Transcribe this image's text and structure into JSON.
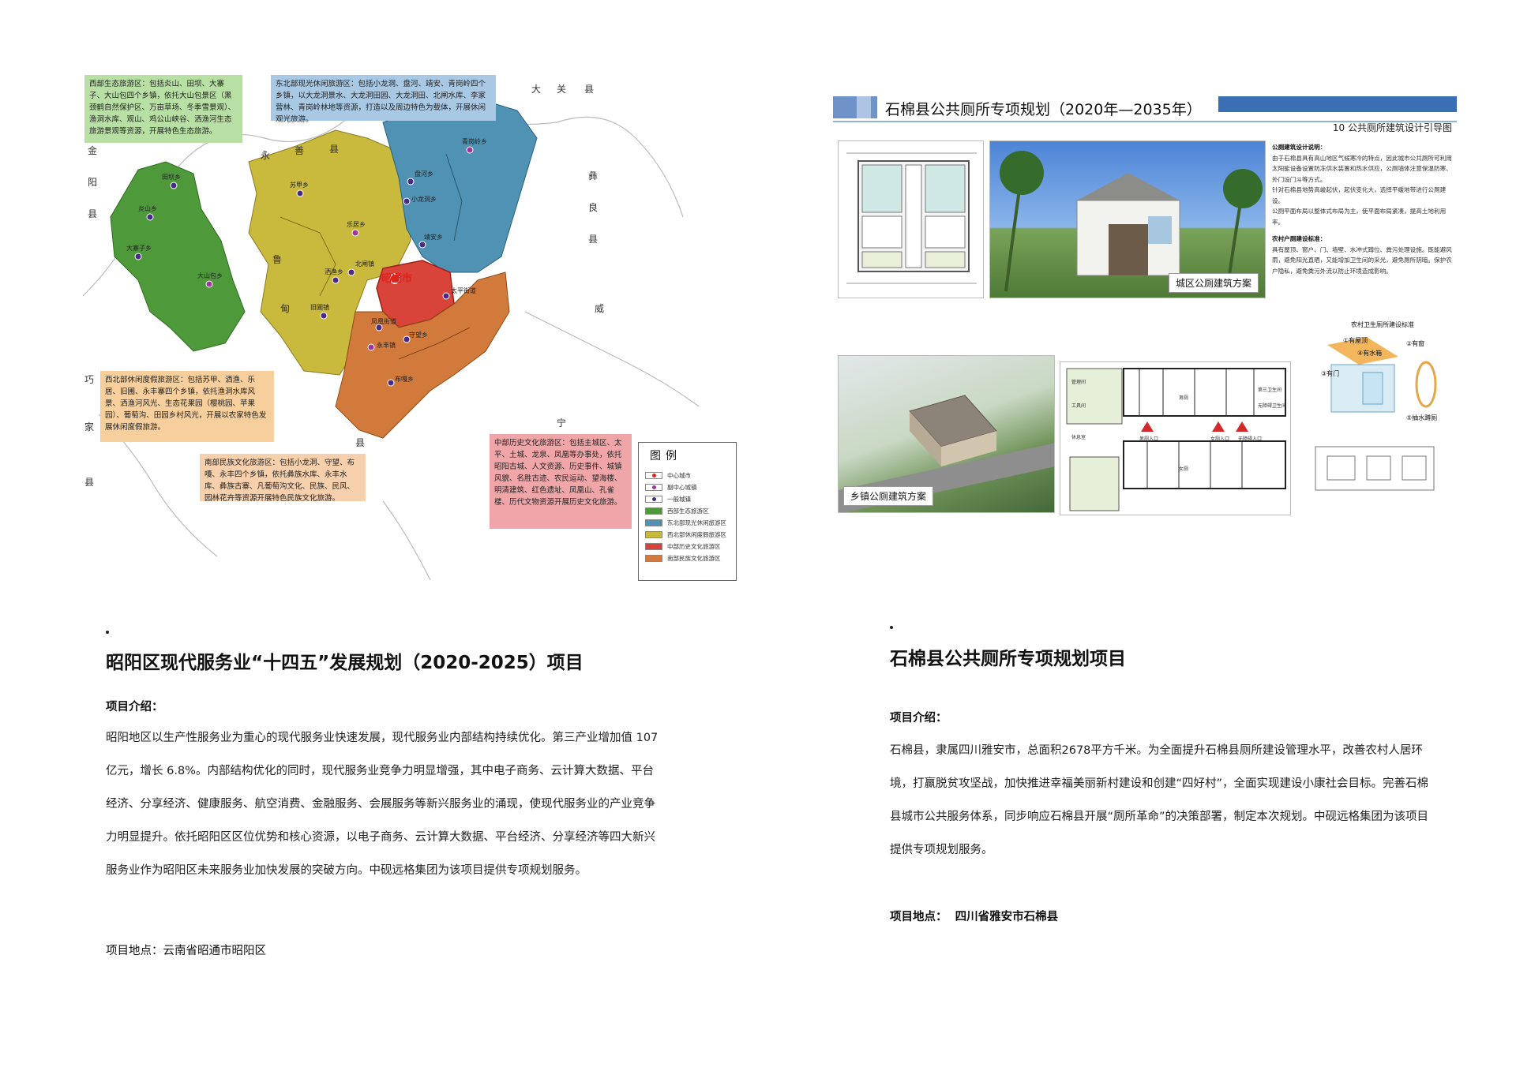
{
  "map": {
    "zone_notes": {
      "west": "西部生态旅游区：包括炎山、田坝、大寨子、大山包四个乡镇，依托大山包景区（黑颈鹤自然保护区、万亩草场、冬季雪景观）、渔洞水库、观山、鸡公山峡谷、洒渔河生态旅游景观等资源，开展特色生态旅游。",
      "northeast": "东北部现光休闲旅游区：包括小龙洞、盘河、靖安、青岗岭四个乡镇，以大龙洞景水、大龙洞田园、大龙洞田、北闸水库、李家营林、青岗岭林地等资源，打造以及周边特色为载体，开展休闲观光旅游。",
      "northwest": "西北部休闲度假旅游区：包括苏甲、洒渔、乐居、旧圃、永丰寨四个乡镇，依托渔洞水库风景、洒渔河风光、生态花果园（樱桃园、苹果园）、葡萄沟、田园乡村风光，开展以农家特色发展休闲度假旅游。",
      "south": "南部民族文化旅游区：包括小龙洞、守望、布嘎、永丰四个乡镇，依托彝族水库、永丰水库、彝族古寨、凡葡萄沟文化、民族、民风、园林花卉等资源开展特色民族文化旅游。",
      "central": "中部历史文化旅游区：包括主城区、太平、土城、龙泉、凤凰等办事处，依托昭阳古城、人文资源、历史事件、城镇风貌、名胜古迹、农民运动、望海楼、明清建筑、红色遗址、凤凰山、孔雀楼、历代文物资源开展历史文化旅游。"
    },
    "county_chars": {
      "jin_yang": [
        "金",
        "阳",
        "县"
      ],
      "yong_shan": [
        "永",
        "善",
        "县"
      ],
      "da_guan": [
        "大",
        "关",
        "县"
      ],
      "yi_liang": [
        "彝",
        "良",
        "县"
      ],
      "lu_dian": [
        "鲁",
        "甸",
        "县"
      ],
      "wei_ning": [
        "威",
        "宁"
      ],
      "qiao_jia": [
        "巧",
        "家",
        "县"
      ]
    },
    "places": {
      "zhaotong": "昭通市",
      "tianba": "田坝乡",
      "dashanbao": "大山包乡",
      "yanshan": "炎山乡",
      "dazhaizi": "大寨子乡",
      "sujia": "苏甲乡",
      "leju": "乐居乡",
      "sayu": "洒渔乡",
      "jingan": "靖安乡",
      "xiaolongdong": "小龙洞乡",
      "panhe": "盘河乡",
      "qinggangling": "青岗岭乡",
      "jiuyan": "旧圃镇",
      "yongfeng": "永丰镇",
      "taiping": "太平街道",
      "bujia": "布嘎乡",
      "shouwang": "守望乡",
      "beizha": "北闸镇",
      "fenghuang": "凤凰街道"
    },
    "legend": {
      "title": "图例",
      "items": [
        {
          "label": "中心城市",
          "swatch": "#ffffff",
          "marker": "center"
        },
        {
          "label": "副中心城镇",
          "swatch": "#ffffff",
          "marker": "sub"
        },
        {
          "label": "一般城镇",
          "swatch": "#ffffff",
          "marker": "town"
        },
        {
          "label": "西部生态旅游区",
          "swatch": "#4e9a3a"
        },
        {
          "label": "东北部现光休闲旅游区",
          "swatch": "#4f92b3"
        },
        {
          "label": "西北部休闲度假旅游区",
          "swatch": "#c9b93c"
        },
        {
          "label": "中部历史文化旅游区",
          "swatch": "#d9443a"
        },
        {
          "label": "南部民族文化旅游区",
          "swatch": "#d27a3c"
        }
      ]
    },
    "colors": {
      "west": "#4e9a3a",
      "northeast": "#4f92b3",
      "northwest": "#c9b93c",
      "central": "#d9443a",
      "south": "#d27a3c"
    }
  },
  "plan_panel": {
    "header_title": "石棉县公共厕所专项规划（2020年—2035年）",
    "sub_title": "10 公共厕所建筑设计引导图",
    "caption_city": "城区公厕建筑方案",
    "caption_town": "乡镇公厕建筑方案",
    "guide": {
      "h1": "公厕建筑设计说明：",
      "p1": "由于石棉县具有高山地区气候寒冷的特点，因此城市公共厕所可利用太阳能设备设置防冻供水装置和热水供应，公厕墙体注意保温防寒、外门设门斗等方式。",
      "p2": "针对石棉县地势高峻起伏，起伏变化大，选择平缓地带进行公厕建设。",
      "p3": "公厕平面布局以整体式布局为主，使平面布局紧凑，提高土地利用率。",
      "h2": "农村户厕建设标准：",
      "p4": "具有屋顶、窗户、门、墙壁、水冲式蹲位、粪污处理设施。既能避风雨，避免阳光直晒，又能增加卫生间的采光，避免厕所阴暗。保护农户隐私，避免粪污外流以防止环境造成影响。"
    },
    "toilet_std": {
      "title": "农村卫生厕所建设标准",
      "l1": "①有屋顶",
      "l2": "②有窗",
      "l3": "③有门",
      "l4": "④有水箱",
      "l5": "⑤抽水蹲厕"
    },
    "floorplan_labels": [
      "男厕",
      "女厕",
      "管理间",
      "工具间",
      "休息室",
      "第三卫生间",
      "无障碍卫生间",
      "男厕入口",
      "女厕入口",
      "无障碍入口"
    ]
  },
  "left_project": {
    "title": "昭阳区现代服务业“十四五”发展规划（2020-2025）项目",
    "intro_label": "项目介绍：",
    "body": "昭阳地区以生产性服务业为重心的现代服务业快速发展，现代服务业内部结构持续优化。第三产业增加值 107亿元，增长 6.8%。内部结构优化的同时，现代服务业竞争力明显增强，其中电子商务、云计算大数据、平台经济、分享经济、健康服务、航空消费、金融服务、会展服务等新兴服务业的涌现，使现代服务业的产业竞争力明显提升。依托昭阳区区位优势和核心资源，以电子商务、云计算大数据、平台经济、分享经济等四大新兴服务业作为昭阳区未来服务业加快发展的突破方向。中砚远格集团为该项目提供专项规划服务。",
    "location_label": "项目地点：",
    "location": "云南省昭通市昭阳区"
  },
  "right_project": {
    "title": "石棉县公共厕所专项规划项目",
    "intro_label": "项目介绍：",
    "body": "石棉县，隶属四川雅安市，总面积2678平方千米。为全面提升石棉县厕所建设管理水平，改善农村人居环境，打赢脱贫攻坚战，加快推进幸福美丽新村建设和创建“四好村”，全面实现建设小康社会目标。完善石棉县城市公共服务体系，同步响应石棉县开展“厕所革命”的决策部署，制定本次规划。中砚远格集团为该项目提供专项规划服务。",
    "location_label": "项目地点：",
    "location": "四川省雅安市石棉县"
  }
}
